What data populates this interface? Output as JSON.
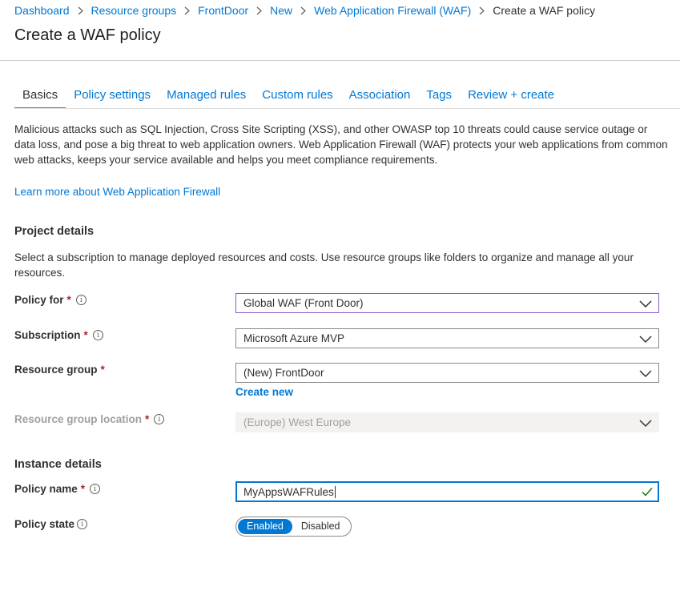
{
  "breadcrumb": {
    "items": [
      "Dashboard",
      "Resource groups",
      "FrontDoor",
      "New",
      "Web Application Firewall (WAF)"
    ],
    "current": "Create a WAF policy"
  },
  "page": {
    "title": "Create a WAF policy"
  },
  "tabs": [
    {
      "label": "Basics",
      "active": true
    },
    {
      "label": "Policy settings"
    },
    {
      "label": "Managed rules"
    },
    {
      "label": "Custom rules"
    },
    {
      "label": "Association"
    },
    {
      "label": "Tags"
    },
    {
      "label": "Review + create"
    }
  ],
  "intro": {
    "description": "Malicious attacks such as SQL Injection, Cross Site Scripting (XSS), and other OWASP top 10 threats could cause service outage or data loss, and pose a big threat to web application owners. Web Application Firewall (WAF) protects your web applications from common web attacks, keeps your service available and helps you meet compliance requirements.",
    "learn_more": "Learn more about Web Application Firewall"
  },
  "project_details": {
    "title": "Project details",
    "description": "Select a subscription to manage deployed resources and costs. Use resource groups like folders to organize and manage all your resources.",
    "policy_for": {
      "label": "Policy for",
      "value": "Global WAF (Front Door)"
    },
    "subscription": {
      "label": "Subscription",
      "value": "Microsoft Azure MVP"
    },
    "resource_group": {
      "label": "Resource group",
      "value": "(New) FrontDoor",
      "create_new": "Create new"
    },
    "resource_group_location": {
      "label": "Resource group location",
      "value": "(Europe) West Europe"
    }
  },
  "instance_details": {
    "title": "Instance details",
    "policy_name": {
      "label": "Policy name",
      "value": "MyAppsWAFRules"
    },
    "policy_state": {
      "label": "Policy state",
      "options": [
        "Enabled",
        "Disabled"
      ],
      "selected": "Enabled"
    }
  },
  "symbols": {
    "required": "*",
    "info": "i"
  },
  "colors": {
    "link": "#0078d4",
    "accent_tab": "#8661c5",
    "required": "#a4262c",
    "toggle_selected": "#0078d4",
    "valid": "#107c10"
  }
}
